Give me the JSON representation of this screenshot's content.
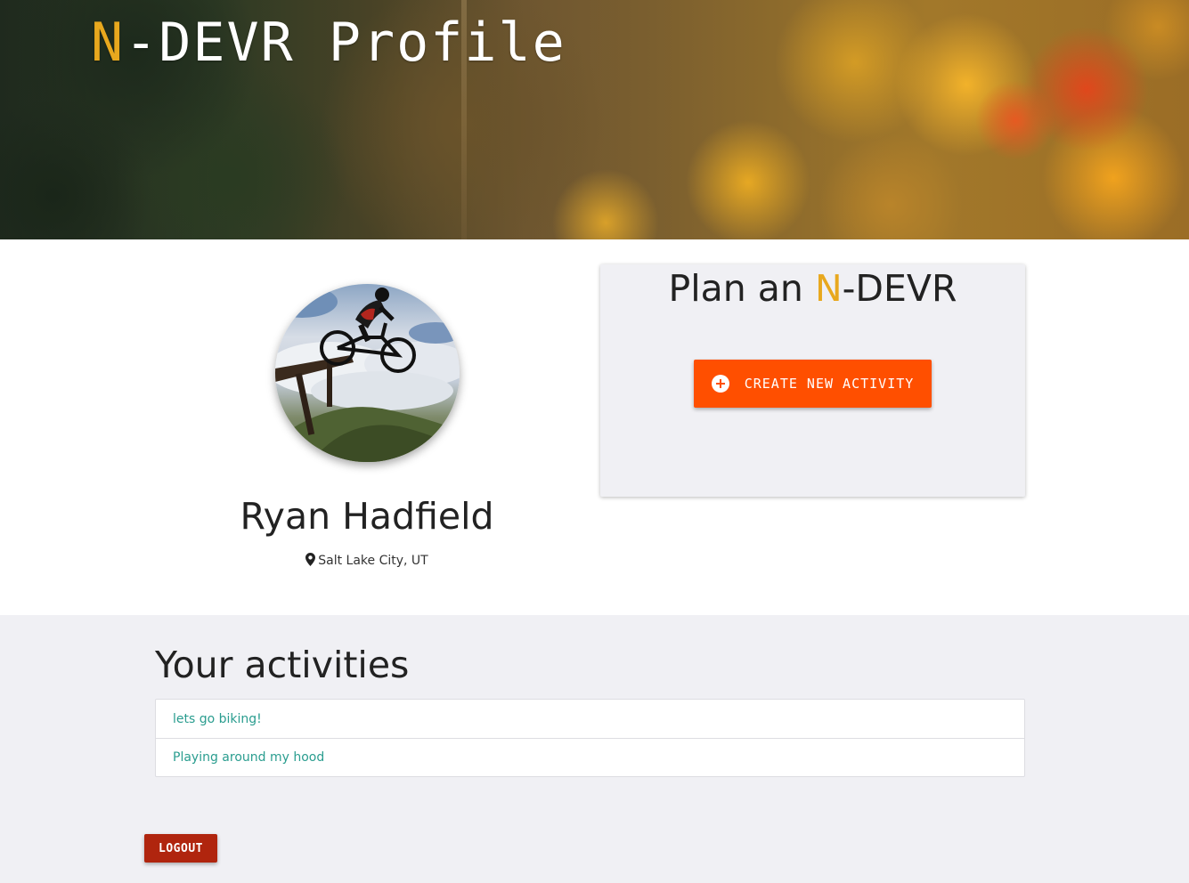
{
  "header": {
    "title_accent": "N",
    "title_rest": "-DEVR Profile"
  },
  "profile": {
    "name": "Ryan Hadfield",
    "location": "Salt Lake City, UT"
  },
  "plan": {
    "title_prefix": "Plan an ",
    "title_accent": "N",
    "title_rest": "-DEVR",
    "create_button_label": "CREATE NEW ACTIVITY"
  },
  "activities": {
    "heading": "Your activities",
    "items": [
      {
        "label": "lets go biking!"
      },
      {
        "label": "Playing around my hood"
      }
    ]
  },
  "logout_label": "LOGOUT",
  "colors": {
    "accent": "#e8a81e",
    "create_button": "#ff4f00",
    "logout_button": "#b0250e",
    "activity_link": "#2a9d8f",
    "section_background": "#f0f0f4"
  }
}
